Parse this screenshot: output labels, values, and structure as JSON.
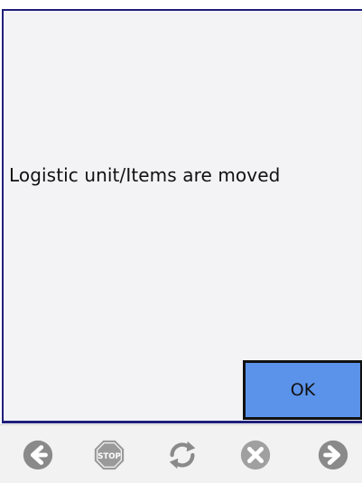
{
  "dialog": {
    "message": "Logistic unit/Items are moved",
    "ok_label": "OK"
  },
  "nav": {
    "icons": [
      "back-arrow-icon",
      "stop-icon",
      "refresh-icon",
      "cancel-icon",
      "forward-arrow-icon"
    ],
    "stop_text": "STOP"
  },
  "colors": {
    "dialog_border": "#1f1f7a",
    "ok_button": "#5b93ea",
    "nav_icon": "#8a8a8a"
  }
}
